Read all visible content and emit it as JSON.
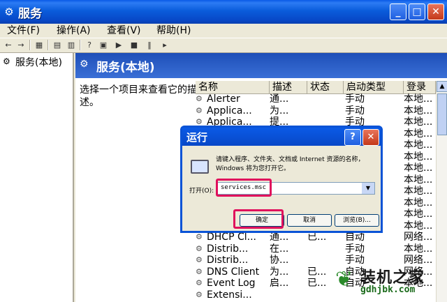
{
  "window": {
    "title": "服务",
    "controls": {
      "minimize": "_",
      "maximize": "□",
      "close": "✕"
    }
  },
  "menu": [
    "文件(F)",
    "操作(A)",
    "查看(V)",
    "帮助(H)"
  ],
  "tree": {
    "root": "服务(本地)"
  },
  "panel": {
    "title": "服务(本地)",
    "description": "选择一个项目来查看它的描述。"
  },
  "columns": [
    "名称",
    "描述",
    "状态",
    "启动类型",
    "登录"
  ],
  "services": [
    {
      "name": "Alerter",
      "desc": "通...",
      "status": "",
      "startup": "手动",
      "logon": "本地..."
    },
    {
      "name": "Applica...",
      "desc": "为...",
      "status": "",
      "startup": "手动",
      "logon": "本地..."
    },
    {
      "name": "Applica...",
      "desc": "提...",
      "status": "",
      "startup": "手动",
      "logon": "本地..."
    },
    {
      "name": "",
      "desc": "",
      "status": "",
      "startup": "",
      "logon": "本地..."
    },
    {
      "name": "",
      "desc": "",
      "status": "",
      "startup": "",
      "logon": "本地..."
    },
    {
      "name": "",
      "desc": "",
      "status": "",
      "startup": "",
      "logon": "本地..."
    },
    {
      "name": "",
      "desc": "",
      "status": "",
      "startup": "",
      "logon": "本地..."
    },
    {
      "name": "",
      "desc": "",
      "status": "",
      "startup": "",
      "logon": "本地..."
    },
    {
      "name": "",
      "desc": "",
      "status": "",
      "startup": "",
      "logon": "本地..."
    },
    {
      "name": "",
      "desc": "",
      "status": "",
      "startup": "",
      "logon": "本地..."
    },
    {
      "name": "",
      "desc": "",
      "status": "",
      "startup": "",
      "logon": "本地..."
    },
    {
      "name": "",
      "desc": "",
      "status": "",
      "startup": "",
      "logon": "本地..."
    },
    {
      "name": "DHCP Cl...",
      "desc": "通...",
      "status": "已...",
      "startup": "自动",
      "logon": "网络..."
    },
    {
      "name": "Distrib...",
      "desc": "在...",
      "status": "",
      "startup": "手动",
      "logon": "本地..."
    },
    {
      "name": "Distrib...",
      "desc": "协...",
      "status": "",
      "startup": "手动",
      "logon": "网络..."
    },
    {
      "name": "DNS Client",
      "desc": "为...",
      "status": "已...",
      "startup": "自动",
      "logon": "网络..."
    },
    {
      "name": "Event Log",
      "desc": "启...",
      "status": "已...",
      "startup": "自动",
      "logon": "本地..."
    },
    {
      "name": "Extensi...",
      "desc": "",
      "status": "",
      "startup": "",
      "logon": ""
    }
  ],
  "run_dialog": {
    "title": "运行",
    "help": "?",
    "close": "✕",
    "message": "请键入程序、文件夹、文档或 Internet 资源的名称，Windows 将为您打开它。",
    "open_label": "打开(O):",
    "open_value": "services.msc",
    "ok": "确定",
    "cancel": "取消",
    "browse": "浏览(B)..."
  },
  "watermark": {
    "text": "装机之家",
    "url": "gdhjbk.com"
  },
  "colors": {
    "highlight": "#e0105c",
    "titlebar": "#0a5ae6",
    "close": "#c4391a"
  }
}
